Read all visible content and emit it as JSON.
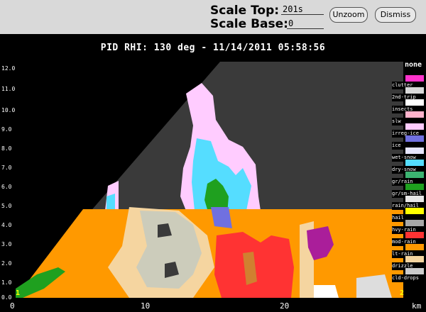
{
  "controls": {
    "scale_top_label": "Scale Top:",
    "scale_top_value": "201s",
    "scale_base_label": "Scale Base:",
    "scale_base_value": "0",
    "unzoom_label": "Unzoom",
    "dismiss_label": "Dismiss"
  },
  "plot": {
    "title": "PID  RHI: 130 deg  -  11/14/2011 05:58:56",
    "y_ticks": [
      "0.0",
      "1.0",
      "2.0",
      "3.0",
      "4.0",
      "5.0",
      "6.0",
      "7.0",
      "8.0",
      "9.0",
      "10.0",
      "11.0",
      "12.0"
    ],
    "x_ticks": [
      "0",
      "10",
      "20"
    ],
    "x_unit": "km",
    "corner_left": "1",
    "corner_right": "2"
  },
  "legend": {
    "title": "none",
    "items": [
      {
        "label": "clutter",
        "color": "#ff33cc"
      },
      {
        "label": "2nd-trip",
        "color": "#d9d9d9"
      },
      {
        "label": "insects",
        "color": "#ffffff"
      },
      {
        "label": "slw",
        "color": "#ffb3cc"
      },
      {
        "label": "irreg-ice",
        "color": "#ffccff"
      },
      {
        "label": "ice",
        "color": "#7070e0"
      },
      {
        "label": "wet-snow",
        "color": "#e6e6ff"
      },
      {
        "label": "dry-snow",
        "color": "#55ddff"
      },
      {
        "label": "gr/rain",
        "color": "#3cb371"
      },
      {
        "label": "gr/sm-hail",
        "color": "#1fa01f"
      },
      {
        "label": "rain/hail",
        "color": "#e8e8e8"
      },
      {
        "label": "hail",
        "color": "#ffff00"
      },
      {
        "label": "hvy-rain",
        "color": "#a8a8a8"
      },
      {
        "label": "mod-rain",
        "color": "#ff3333"
      },
      {
        "label": "lt-rain",
        "color": "#ff9900"
      },
      {
        "label": "drizzle",
        "color": "#f5d5a0"
      },
      {
        "label": "cld-drops",
        "color": "#cccccc"
      }
    ]
  }
}
